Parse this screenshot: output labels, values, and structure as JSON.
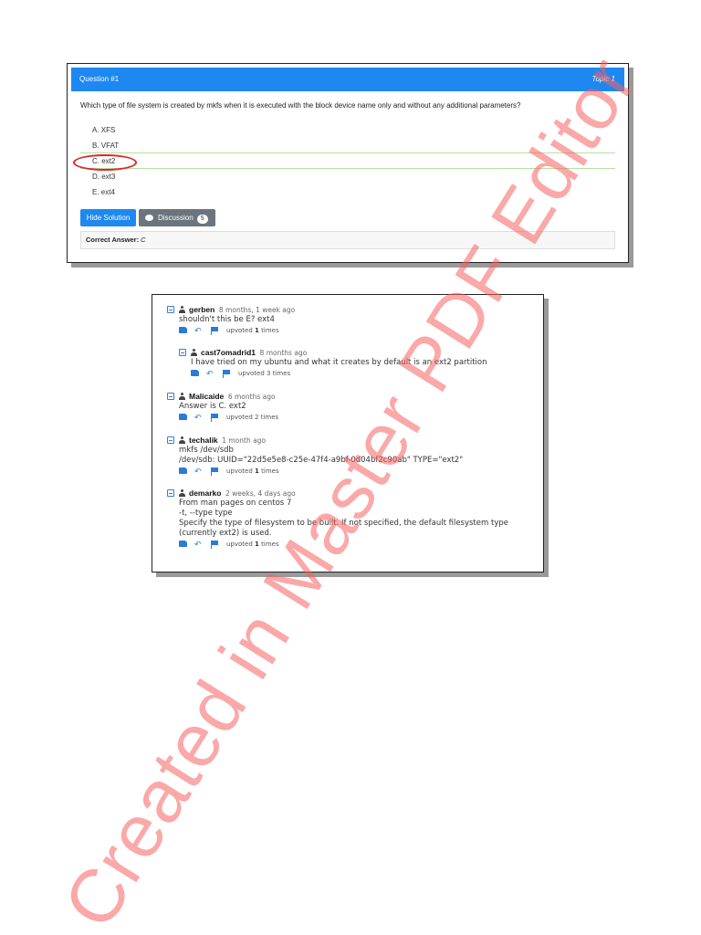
{
  "question": {
    "title": "Question #1",
    "topic": "Topic 1",
    "text": "Which type of file system is created by mkfs when it is executed with the block device name only and without any additional parameters?",
    "choices": [
      "A. XFS",
      "B. VFAT",
      "C. ext2",
      "D. ext3",
      "E. ext4"
    ],
    "highlighted_choice": "C. ext2",
    "hide_solution_label": "Hide Solution",
    "discussion_label": "Discussion",
    "discussion_count": "5",
    "correct_answer_label": "Correct Answer:",
    "correct_answer_value": "C"
  },
  "comments": [
    {
      "user": "gerben",
      "time": "8 months, 1 week ago",
      "body": [
        "shouldn't this be E? ext4"
      ],
      "upvotes_prefix": "upvoted",
      "upvotes": "1",
      "upvotes_suffix": "times"
    },
    {
      "user": "cast7omadrid1",
      "time": "8 months ago",
      "body": [
        "I have tried on my ubuntu and what it creates by default is an ext2 partition"
      ],
      "upvotes_text": "upvoted 3 times"
    },
    {
      "user": "Malicaide",
      "time": "6 months ago",
      "body": [
        "Answer is C. ext2"
      ],
      "upvotes_text": "upvoted 2 times"
    },
    {
      "user": "techalik",
      "time": "1 month ago",
      "body": [
        "mkfs /dev/sdb",
        "/dev/sdb: UUID=\"22d5e5e8-c25e-47f4-a9bf-0d04bf2c90ab\" TYPE=\"ext2\""
      ],
      "upvotes_prefix": "upvoted",
      "upvotes": "1",
      "upvotes_suffix": "times"
    },
    {
      "user": "demarko",
      "time": "2 weeks, 4 days ago",
      "body": [
        "From man pages on centos 7",
        "-t, --type type",
        "Specify the type of filesystem to be built. If not specified, the default filesystem type",
        "(currently ext2) is used."
      ],
      "upvotes_prefix": "upvoted",
      "upvotes": "1",
      "upvotes_suffix": "times"
    }
  ],
  "watermark": "Created in Master PDF Editor",
  "colors": {
    "accent": "#1e88f0",
    "secondary": "#6c757d",
    "highlight_circle": "#d92a2a",
    "watermark": "#f66060"
  }
}
